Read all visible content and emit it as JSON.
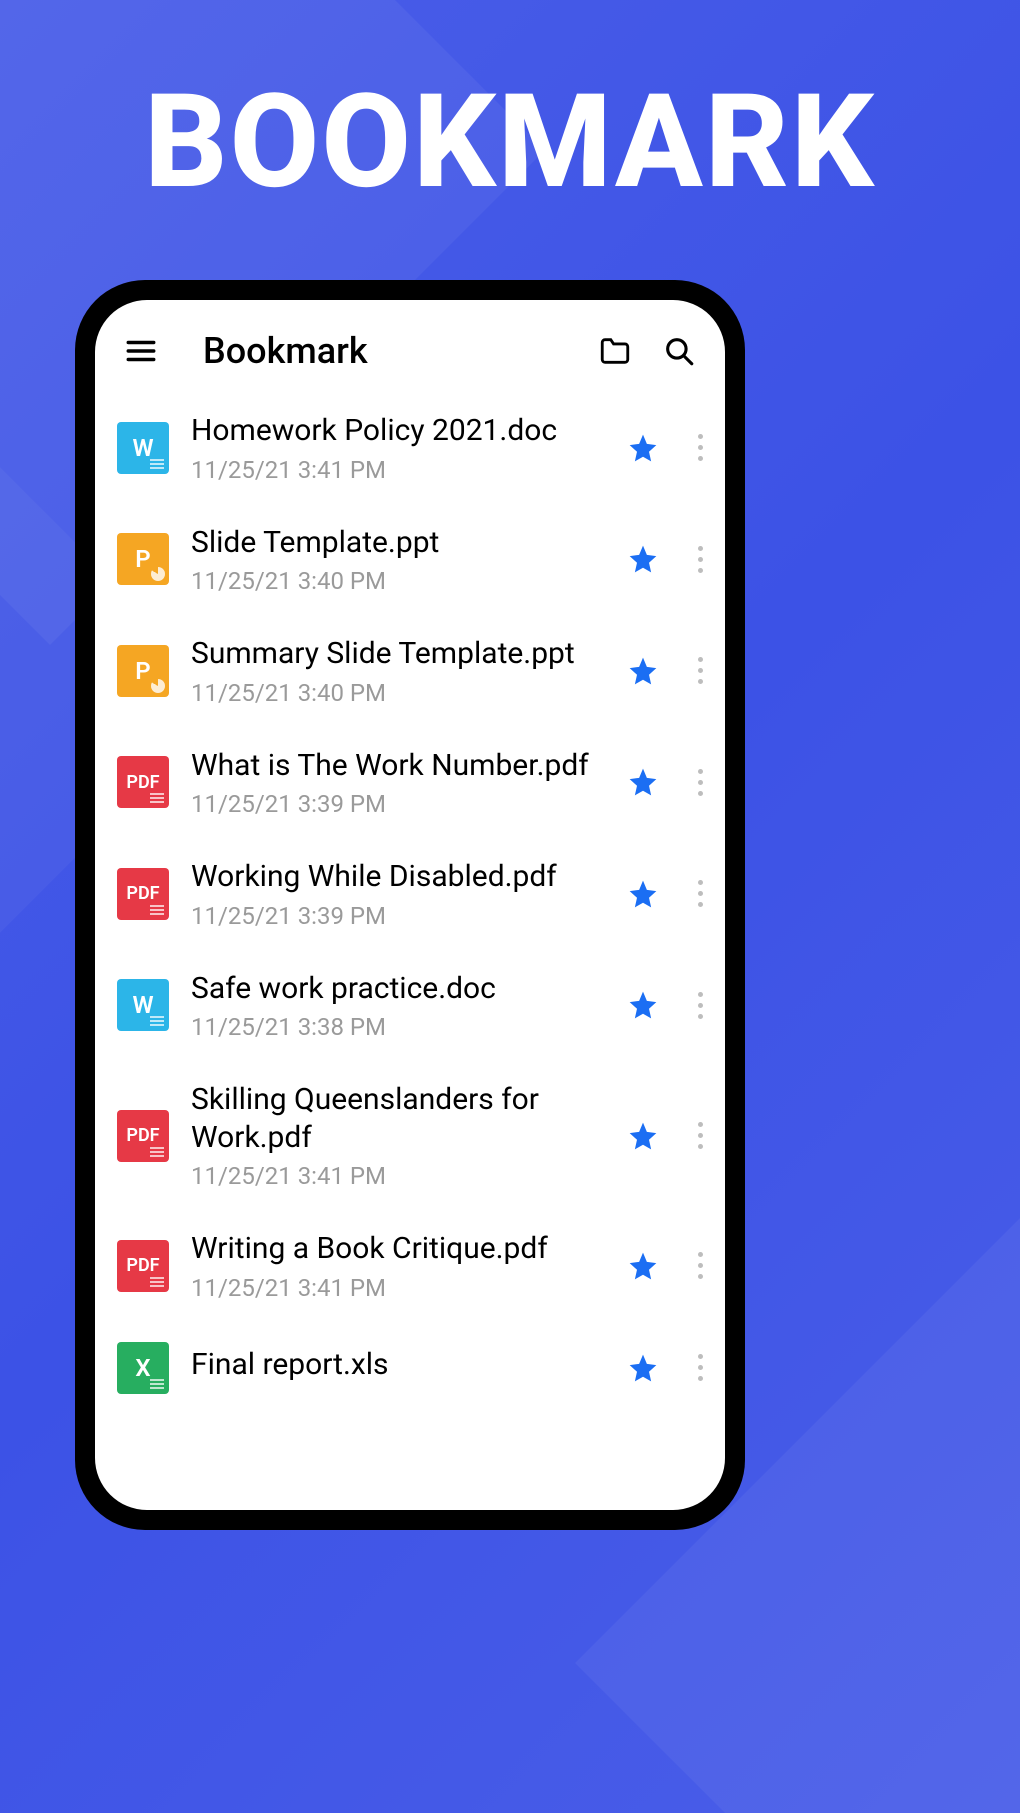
{
  "hero": {
    "title": "BOOKMARK"
  },
  "appbar": {
    "title": "Bookmark"
  },
  "icons": {
    "menu": "menu-icon",
    "folder": "folder-icon",
    "search": "search-icon",
    "star": "star-icon",
    "more": "more-vertical-icon"
  },
  "files": [
    {
      "label": "W",
      "type": "word",
      "name": "Homework Policy 2021.doc",
      "date": "11/25/21 3:41 PM"
    },
    {
      "label": "P",
      "type": "ppt",
      "name": "Slide Template.ppt",
      "date": "11/25/21 3:40 PM"
    },
    {
      "label": "P",
      "type": "ppt",
      "name": "Summary Slide Template.ppt",
      "date": "11/25/21 3:40 PM"
    },
    {
      "label": "PDF",
      "type": "pdf",
      "name": "What is The Work Number.pdf",
      "date": "11/25/21 3:39 PM"
    },
    {
      "label": "PDF",
      "type": "pdf",
      "name": "Working While Disabled.pdf",
      "date": "11/25/21 3:39 PM"
    },
    {
      "label": "W",
      "type": "word",
      "name": "Safe work practice.doc",
      "date": "11/25/21 3:38 PM"
    },
    {
      "label": "PDF",
      "type": "pdf",
      "name": "Skilling Queenslanders for Work.pdf",
      "date": "11/25/21 3:41 PM"
    },
    {
      "label": "PDF",
      "type": "pdf",
      "name": "Writing a Book Critique.pdf",
      "date": "11/25/21 3:41 PM"
    },
    {
      "label": "X",
      "type": "xls",
      "name": "Final report.xls",
      "date": ""
    }
  ]
}
